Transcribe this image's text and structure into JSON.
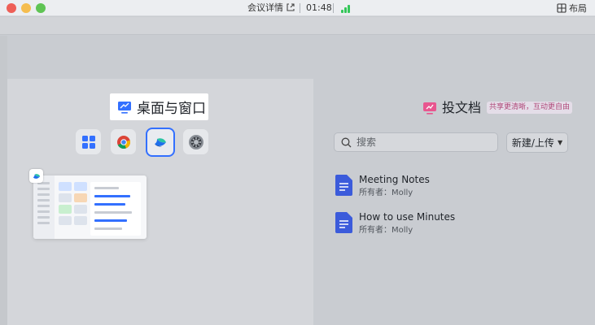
{
  "titlebar": {
    "meeting_title": "会议详情",
    "time": "01:48",
    "layout_label": "布局"
  },
  "share": {
    "desktop_label": "桌面与窗口",
    "apps": [
      {
        "icon": "app-grid-icon"
      },
      {
        "icon": "chrome-icon"
      },
      {
        "icon": "meeting-app-icon",
        "selected": true
      },
      {
        "icon": "settings-gear-icon"
      }
    ]
  },
  "cast": {
    "title": "投文档",
    "badge": "共享更清晰，互动更自由",
    "search_placeholder": "搜索",
    "upload_label": "新建/上传",
    "documents": [
      {
        "name": "Meeting Notes",
        "owner": "所有者：Molly"
      },
      {
        "name": "How to use Minutes",
        "owner": "所有者：Molly"
      }
    ]
  },
  "colors": {
    "accent": "#3370ff",
    "doc_icon": "#3b5bdb",
    "badge_text": "#b04a7a",
    "signal": "#34c759"
  }
}
